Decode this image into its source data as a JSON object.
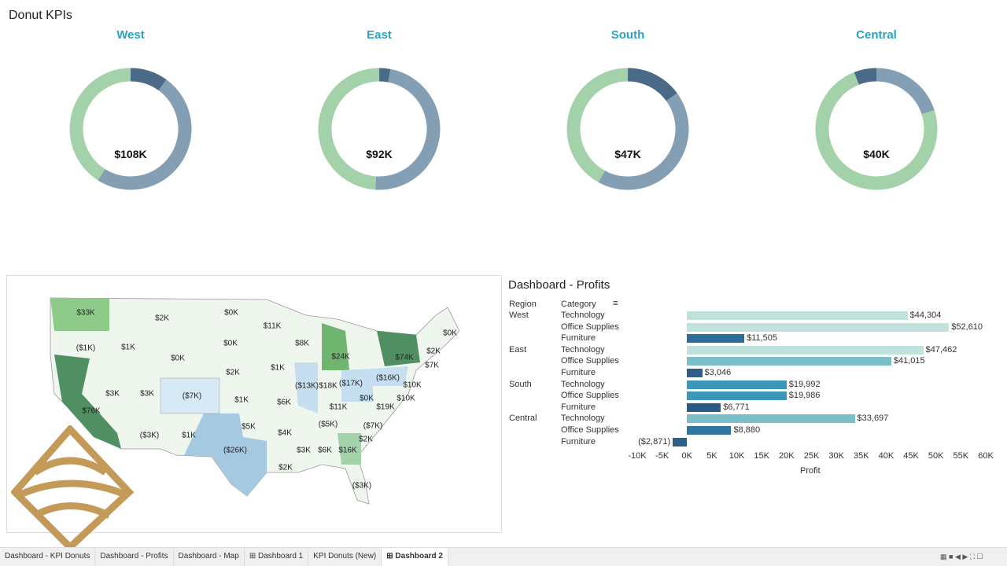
{
  "title": "Donut KPIs",
  "donuts": [
    {
      "region": "West",
      "value": "$108K",
      "segments": [
        0.1,
        0.49,
        0.41
      ]
    },
    {
      "region": "East",
      "value": "$92K",
      "segments": [
        0.03,
        0.48,
        0.49
      ]
    },
    {
      "region": "South",
      "value": "$47K",
      "segments": [
        0.15,
        0.43,
        0.42
      ]
    },
    {
      "region": "Central",
      "value": "$40K",
      "segments": [
        0.06,
        0.2,
        0.74
      ]
    }
  ],
  "donut_colors": [
    "#4b6a87",
    "#849eb3",
    "#a3d1a9"
  ],
  "map": {
    "labels": [
      [
        "$33K",
        100,
        47
      ],
      [
        "$2K",
        197,
        54
      ],
      [
        "$0K",
        285,
        47
      ],
      [
        "$11K",
        337,
        64
      ],
      [
        "$0K",
        563,
        73
      ],
      [
        "($1K)",
        100,
        92
      ],
      [
        "$1K",
        154,
        91
      ],
      [
        "$0K",
        284,
        86
      ],
      [
        "$8K",
        375,
        86
      ],
      [
        "$24K",
        424,
        103
      ],
      [
        "$74K",
        505,
        104
      ],
      [
        "$2K",
        542,
        96
      ],
      [
        "$7K",
        540,
        114
      ],
      [
        "$0K",
        217,
        105
      ],
      [
        "$2K",
        287,
        123
      ],
      [
        "$1K",
        344,
        117
      ],
      [
        "($13K)",
        381,
        140
      ],
      [
        "$18K",
        408,
        140
      ],
      [
        "($17K)",
        437,
        137
      ],
      [
        "($16K)",
        484,
        130
      ],
      [
        "$10K",
        515,
        139
      ],
      [
        "$3K",
        134,
        150
      ],
      [
        "$3K",
        178,
        150
      ],
      [
        "($7K)",
        235,
        153
      ],
      [
        "$1K",
        298,
        158
      ],
      [
        "$6K",
        352,
        161
      ],
      [
        "$0K",
        457,
        156
      ],
      [
        "$10K",
        507,
        156
      ],
      [
        "$11K",
        421,
        167
      ],
      [
        "$19K",
        481,
        167
      ],
      [
        "$5K",
        307,
        192
      ],
      [
        "($5K)",
        408,
        189
      ],
      [
        "($7K)",
        465,
        191
      ],
      [
        "$76K",
        107,
        172
      ],
      [
        "($3K)",
        181,
        203
      ],
      [
        "$1K",
        231,
        203
      ],
      [
        "$4K",
        353,
        200
      ],
      [
        "$2K",
        456,
        208
      ],
      [
        "($26K)",
        290,
        222
      ],
      [
        "$3K",
        377,
        222
      ],
      [
        "$6K",
        404,
        222
      ],
      [
        "$16K",
        433,
        222
      ],
      [
        "$2K",
        354,
        244
      ],
      [
        "($3K)",
        451,
        267
      ]
    ]
  },
  "profits": {
    "title": "Dashboard - Profits",
    "col_region": "Region",
    "col_category": "Category",
    "xlabel": "Profit"
  },
  "chart_data": {
    "type": "bar",
    "title": "Dashboard - Profits",
    "xlabel": "Profit",
    "xlim": [
      -10000,
      60000
    ],
    "ticks": [
      "-10K",
      "-5K",
      "0K",
      "5K",
      "10K",
      "15K",
      "20K",
      "25K",
      "30K",
      "35K",
      "40K",
      "45K",
      "50K",
      "55K",
      "60K"
    ],
    "rows": [
      {
        "region": "West",
        "category": "Technology",
        "value": 44304,
        "label": "$44,304"
      },
      {
        "region": "",
        "category": "Office Supplies",
        "value": 52610,
        "label": "$52,610"
      },
      {
        "region": "",
        "category": "Furniture",
        "value": 11505,
        "label": "$11,505"
      },
      {
        "region": "East",
        "category": "Technology",
        "value": 47462,
        "label": "$47,462"
      },
      {
        "region": "",
        "category": "Office Supplies",
        "value": 41015,
        "label": "$41,015"
      },
      {
        "region": "",
        "category": "Furniture",
        "value": 3046,
        "label": "$3,046"
      },
      {
        "region": "South",
        "category": "Technology",
        "value": 19992,
        "label": "$19,992"
      },
      {
        "region": "",
        "category": "Office Supplies",
        "value": 19986,
        "label": "$19,986"
      },
      {
        "region": "",
        "category": "Furniture",
        "value": 6771,
        "label": "$6,771"
      },
      {
        "region": "Central",
        "category": "Technology",
        "value": 33697,
        "label": "$33,697"
      },
      {
        "region": "",
        "category": "Office Supplies",
        "value": 8880,
        "label": "$8,880"
      },
      {
        "region": "",
        "category": "Furniture",
        "value": -2871,
        "label": "($2,871)"
      }
    ]
  },
  "tabs": [
    "Dashboard - KPI Donuts",
    "Dashboard - Profits",
    "Dashboard - Map",
    "⊞ Dashboard 1",
    "KPI Donuts (New)",
    "⊞ Dashboard 2"
  ],
  "active_tab": 5
}
